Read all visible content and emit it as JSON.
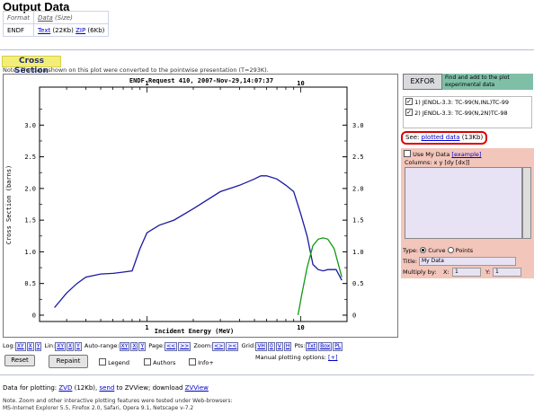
{
  "output_data": {
    "title": "Output Data",
    "hdr_format": "Format",
    "hdr_data_link": "Data",
    "hdr_data_size": "(Size)",
    "format": "ENDF",
    "text_link": "Text",
    "text_size": "(22Kb)",
    "zip_link": "ZIP",
    "zip_size": "(6Kb)"
  },
  "cross_section": {
    "title": "Cross Section",
    "note": "Note. The data shown on this plot were converted to the pointwise presentation (T=293K)."
  },
  "plot": {
    "header": "ENDF Request 410, 2007-Nov-29,14:07:37",
    "ylabel": "Cross Section (barns)",
    "xlabel": "Incident Energy (MeV)"
  },
  "chart_data": {
    "type": "line",
    "title": "ENDF Request 410, 2007-Nov-29,14:07:37",
    "xlabel": "Incident Energy (MeV)",
    "ylabel": "Cross Section (barns)",
    "xscale": "log",
    "xlim": [
      0.2,
      20
    ],
    "ylim": [
      -0.1,
      3.6
    ],
    "xticks": [
      "1",
      "10"
    ],
    "yticks": [
      "0",
      "0.5",
      "1.0",
      "1.5",
      "2.0",
      "2.5",
      "3.0"
    ],
    "grid": false,
    "series": [
      {
        "name": "JENDL-3.3: TC-99(N,INL)TC-99",
        "color": "#1a1aa0",
        "x": [
          0.25,
          0.3,
          0.35,
          0.4,
          0.5,
          0.6,
          0.7,
          0.8,
          0.9,
          1.0,
          1.2,
          1.5,
          2.0,
          3.0,
          4.0,
          5.0,
          5.5,
          6.0,
          7.0,
          8.0,
          9.0,
          10.0,
          11.0,
          12.0,
          13.0,
          14.0,
          15.0,
          17.0,
          18.5
        ],
        "y": [
          0.12,
          0.35,
          0.5,
          0.6,
          0.65,
          0.66,
          0.68,
          0.7,
          1.05,
          1.3,
          1.42,
          1.5,
          1.68,
          1.95,
          2.05,
          2.15,
          2.2,
          2.2,
          2.15,
          2.05,
          1.95,
          1.6,
          1.25,
          0.8,
          0.72,
          0.7,
          0.72,
          0.72,
          0.55
        ]
      },
      {
        "name": "JENDL-3.3: TC-99(N,2N)TC-98",
        "color": "#119a11",
        "x": [
          9.6,
          10.2,
          11.0,
          12.0,
          13.0,
          14.0,
          15.0,
          16.5,
          18.5
        ],
        "y": [
          0.0,
          0.35,
          0.75,
          1.1,
          1.2,
          1.22,
          1.2,
          1.05,
          0.6
        ]
      }
    ]
  },
  "right_panel": {
    "exfor_button": "EXFOR",
    "exfor_text": "Find and add to the plot experimental data",
    "datasets": [
      {
        "label": "1)  JENDL-3.3: TC-99(N,INL)TC-99",
        "checked": true
      },
      {
        "label": "2)  JENDL-3.3: TC-99(N,2N)TC-98",
        "checked": true
      }
    ],
    "see_prefix": "See:",
    "plotted_data_link": "plotted data",
    "plotted_data_size": "(13Kb)",
    "use_my_data": "Use My Data",
    "example_link": "[example]",
    "columns_label": "Columns: x y [dy [dx]]",
    "type_label": "Type:",
    "curve_label": "Curve",
    "points_label": "Points",
    "title_label": "Title:",
    "title_value": "My Data",
    "multiply_label": "Multiply by:",
    "x_label": "X:",
    "x_value": "1",
    "y_label": "Y:",
    "y_value": "1"
  },
  "toolbar": {
    "log_label": "Log:",
    "xy": "XY",
    "x": "X",
    "y": "Y",
    "lin_label": "Lin:",
    "autorange_label": "Auto-range:",
    "page_label": "Page:",
    "prev": "<<",
    "next": ">>",
    "zoom_label": "Zoom:",
    "zoom_in": "<>",
    "zoom_out": "><",
    "grid_label": "Grid:",
    "grid_vh": "VH",
    "grid_0": "0",
    "grid_v": "V",
    "grid_h": "H",
    "pts_label": "Pts:",
    "pts_txt": "Txt",
    "pts_box": "Box",
    "pts_pl": "PL",
    "reset": "Reset",
    "repaint": "Repaint",
    "legend": "Legend",
    "authors": "Authors",
    "info": "Info+",
    "manual": "Manual plotting options:",
    "manual_link": "[+]"
  },
  "footer": {
    "data_for_plotting": "Data for plotting:",
    "zvd_link": "ZVD",
    "zvd_size": "(12Kb),",
    "send_link": "send",
    "to_zvview": "to ZVView; download",
    "zvview_link": "ZVView",
    "note": "Note. Zoom and other interactive plotting features were tested under Web-browsers:",
    "browsers": "MS-Internet Explorer 5.5, Firefox 2.0, Safari, Opera 9.1, Netscape v-7.2"
  }
}
